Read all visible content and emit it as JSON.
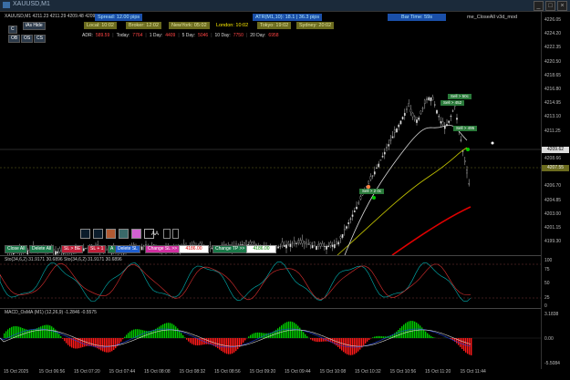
{
  "window": {
    "title": "XAUUSD,M1"
  },
  "ohlc": "XAUUSD,M1  4211.23 4211.29 4209.48 4209.62",
  "topbar": {
    "spread": "Spread: 12.00 pips",
    "atr": "ATR(M1,10): 18.1 | 36.3 pips",
    "bar_time": "Bar Time: 59s",
    "ea_name": "me_CloseAll v3d_mod"
  },
  "sessions": {
    "local": "Local: 10:02",
    "broker": "Broker: 12:02",
    "newyork": "NewYork: 05:02",
    "london": "London: 10:02",
    "tokyo": "Tokyo: 19:02",
    "sydney": "Sydney: 20:02"
  },
  "left_buttons": {
    "hide": "iAs Hide",
    "b1": "C",
    "b2": "OB",
    "b3": "OS"
  },
  "adr": {
    "label": "ADR:",
    "adr_val": "589.59",
    "today_l": "Today:",
    "today_v": "7764",
    "d1_l": "1 Day:",
    "d1_v": "4409",
    "d5_l": "5 Day:",
    "d5_v": "5046",
    "d10_l": "10 Day:",
    "d10_v": "7750",
    "d20_l": "20 Day:",
    "d20_v": "6958"
  },
  "price_axis": [
    "4226.05",
    "4224.20",
    "4222.35",
    "4220.50",
    "4218.65",
    "4216.80",
    "4214.95",
    "4213.10",
    "4211.25",
    "4209.62",
    "4208.66",
    "4207.55",
    "4206.70",
    "4204.85",
    "4203.00",
    "4201.15",
    "4199.30"
  ],
  "trade_labels": {
    "l1": "Sell > 2 0c",
    "l2": "Sell > 495",
    "l3": "Sell > 452",
    "l4": "Sell > 50c"
  },
  "toolbar": {
    "close_all": "Close All",
    "delete_all": "Delete All",
    "sl_be": "SL > BE",
    "sl_1": "SL + 1",
    "a": "A",
    "delete_sl": "Delete SL",
    "change_sl": "Change SL >>",
    "sl_value": "4186.00",
    "change_tp": "Change TP >>",
    "tp_value": "4186.00",
    "aa": "AA"
  },
  "stoch": {
    "title": "Sto(34,6,2) 31.9171 30.6896  Sto(34,6,2) 31.9171 30.6896",
    "levels": [
      "100",
      "75",
      "50",
      "25",
      "0"
    ]
  },
  "macd": {
    "title": "MACD_OsMA (M1) (12,26,9) -1.2846 -0.5575",
    "levels": [
      "3.1838",
      "0.00",
      "-5.5084"
    ]
  },
  "time_axis": [
    "15 Oct 2025",
    "15 Oct 06:56",
    "15 Oct 07:20",
    "15 Oct 07:44",
    "15 Oct 08:08",
    "15 Oct 08:32",
    "15 Oct 08:56",
    "15 Oct 09:20",
    "15 Oct 09:44",
    "15 Oct 10:08",
    "15 Oct 10:32",
    "15 Oct 10:56",
    "15 Oct 11:20",
    "15 Oct 11:44"
  ],
  "colors": {
    "up": "#00c800",
    "down": "#ff1a1a",
    "ma_fast": "#d8d8d8",
    "ma_slow": "#c8c800",
    "ma_red": "#e00000",
    "accent_blue": "#2060d0"
  }
}
